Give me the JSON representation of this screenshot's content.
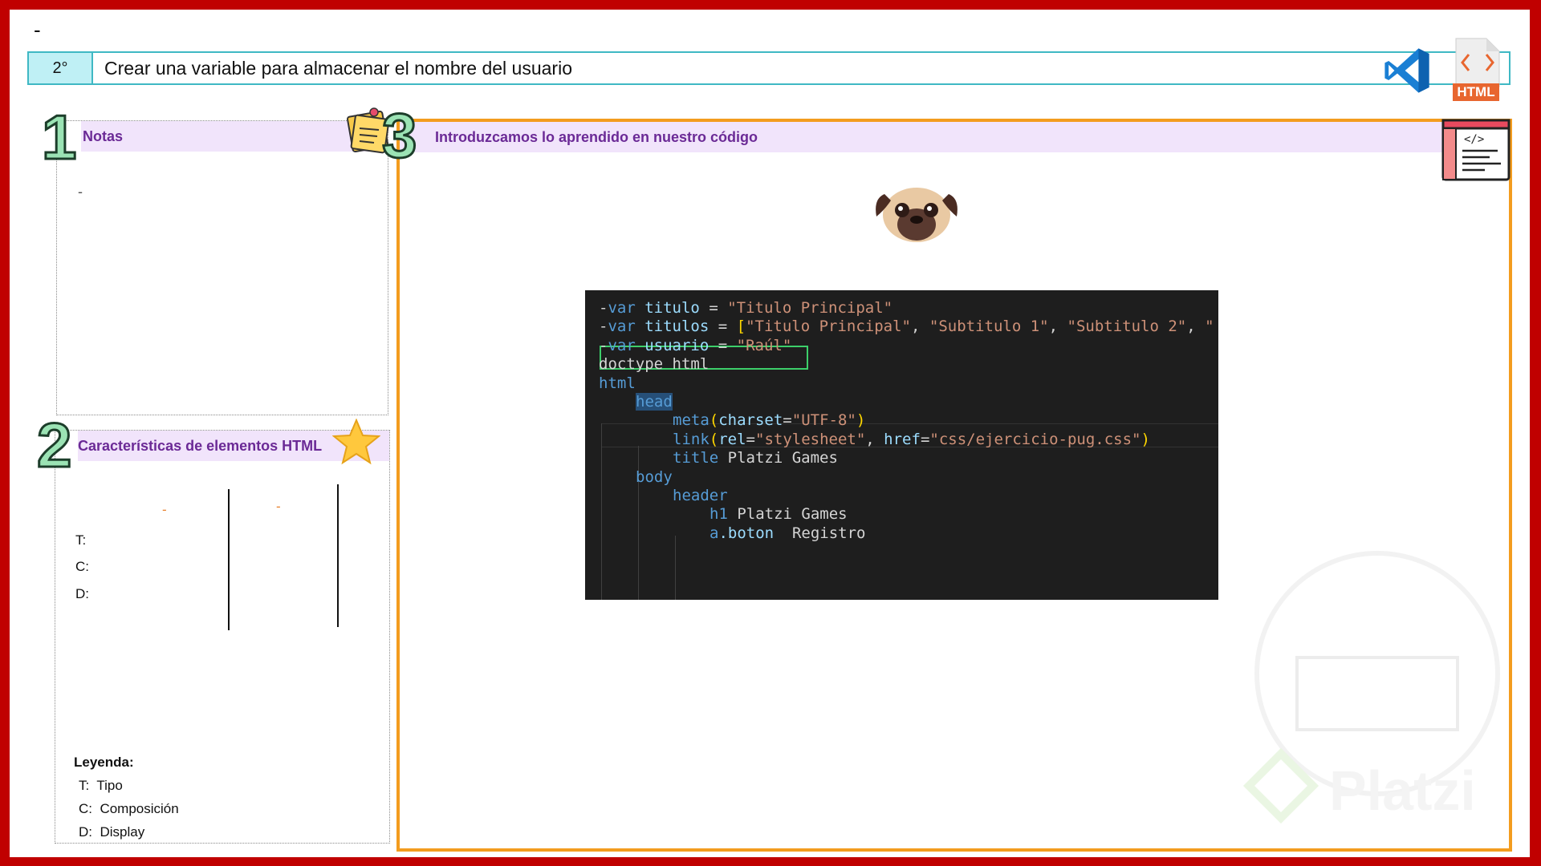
{
  "header": {
    "top_dash": "-",
    "step_number": "2°",
    "step_title": "Crear una variable para almacenar el nombre del usuario",
    "html_badge_label": "HTML"
  },
  "notes": {
    "number": "1",
    "title": "Notas",
    "placeholder_dash": "-"
  },
  "html_features": {
    "number": "2",
    "title": "Características de elementos HTML",
    "col1_dash": "-",
    "col2_dash": "-",
    "row_labels": [
      "T:",
      "C:",
      "D:"
    ],
    "legend_title": "Leyenda:",
    "legend": [
      {
        "key": "T:",
        "value": "Tipo"
      },
      {
        "key": "C:",
        "value": "Composición"
      },
      {
        "key": "D:",
        "value": "Display"
      }
    ]
  },
  "main": {
    "number": "3",
    "title": "Introduzcamos lo aprendido en nuestro código"
  },
  "code": {
    "lines": [
      {
        "indent": 0,
        "parts": [
          [
            "pl",
            "-"
          ],
          [
            "kw",
            "var"
          ],
          [
            "pl",
            " "
          ],
          [
            "id",
            "titulo"
          ],
          [
            "pl",
            " = "
          ],
          [
            "str",
            "\"Titulo Principal\""
          ]
        ]
      },
      {
        "indent": 0,
        "parts": [
          [
            "pl",
            "-"
          ],
          [
            "kw",
            "var"
          ],
          [
            "pl",
            " "
          ],
          [
            "id",
            "titulos"
          ],
          [
            "pl",
            " = "
          ],
          [
            "paren",
            "["
          ],
          [
            "str",
            "\"Titulo Principal\""
          ],
          [
            "pl",
            ", "
          ],
          [
            "str",
            "\"Subtitulo 1\""
          ],
          [
            "pl",
            ", "
          ],
          [
            "str",
            "\"Subtitulo 2\""
          ],
          [
            "pl",
            ", "
          ],
          [
            "str",
            "\""
          ]
        ]
      },
      {
        "indent": 0,
        "parts": [
          [
            "pl",
            "-"
          ],
          [
            "kw",
            "var"
          ],
          [
            "pl",
            " "
          ],
          [
            "id",
            "usuario"
          ],
          [
            "pl",
            " = "
          ],
          [
            "str",
            "\"Raúl\""
          ]
        ]
      },
      {
        "indent": 0,
        "parts": [
          [
            "pl",
            "doctype html"
          ]
        ]
      },
      {
        "indent": 0,
        "parts": [
          [
            "tag",
            "html"
          ]
        ]
      },
      {
        "indent": 1,
        "parts": [
          [
            "tag",
            "head"
          ]
        ]
      },
      {
        "indent": 2,
        "parts": [
          [
            "tag",
            "meta"
          ],
          [
            "paren",
            "("
          ],
          [
            "attr",
            "charset"
          ],
          [
            "pl",
            "="
          ],
          [
            "str",
            "\"UTF-8\""
          ],
          [
            "paren",
            ")"
          ]
        ]
      },
      {
        "indent": 2,
        "parts": [
          [
            "tag",
            "link"
          ],
          [
            "paren",
            "("
          ],
          [
            "attr",
            "rel"
          ],
          [
            "pl",
            "="
          ],
          [
            "str",
            "\"stylesheet\""
          ],
          [
            "pl",
            ", "
          ],
          [
            "attr",
            "href"
          ],
          [
            "pl",
            "="
          ],
          [
            "str",
            "\"css/ejercicio-pug.css\""
          ],
          [
            "paren",
            ")"
          ]
        ]
      },
      {
        "indent": 2,
        "parts": [
          [
            "tag",
            "title"
          ],
          [
            "pl",
            " Platzi Games"
          ]
        ]
      },
      {
        "indent": 1,
        "parts": [
          [
            "tag",
            "body"
          ]
        ]
      },
      {
        "indent": 2,
        "parts": [
          [
            "tag",
            "header"
          ]
        ]
      },
      {
        "indent": 3,
        "parts": [
          [
            "tag",
            "h1"
          ],
          [
            "pl",
            " Platzi Games"
          ]
        ]
      },
      {
        "indent": 3,
        "parts": [
          [
            "tag",
            "a"
          ],
          [
            "attr",
            ".boton"
          ],
          [
            "pl",
            "  Registro"
          ]
        ]
      }
    ]
  },
  "icons": {
    "vscode": "vscode-logo-icon",
    "html_file": "html-file-icon",
    "sticky_note": "sticky-note-icon",
    "star": "star-icon",
    "pug": "pug-dog-icon",
    "code_window": "code-window-icon"
  },
  "colors": {
    "frame": "#c00000",
    "accent_orange": "#f39c1e",
    "teal": "#3fb8c4",
    "header_purple": "#6b2a96"
  }
}
